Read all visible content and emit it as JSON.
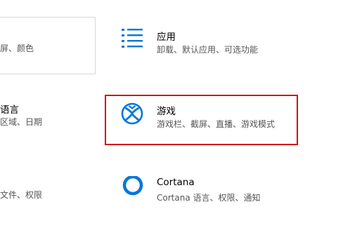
{
  "left_column": {
    "top_item": {
      "subtitle": "屏、颜色"
    },
    "middle_item": {
      "title": "语言",
      "subtitle": "区域、日期"
    },
    "bottom_item": {
      "subtitle": "文件、权限"
    }
  },
  "tiles": {
    "apps": {
      "title": "应用",
      "subtitle": "卸载、默认应用、可选功能",
      "icon": "apps-list-icon"
    },
    "gaming": {
      "title": "游戏",
      "subtitle": "游戏栏、截屏、直播、游戏模式",
      "icon": "xbox-icon"
    },
    "cortana": {
      "title": "Cortana",
      "subtitle": "Cortana 语言、权限、通知",
      "icon": "cortana-icon"
    }
  },
  "colors": {
    "accent": "#0078d7",
    "highlight": "#d01313"
  }
}
